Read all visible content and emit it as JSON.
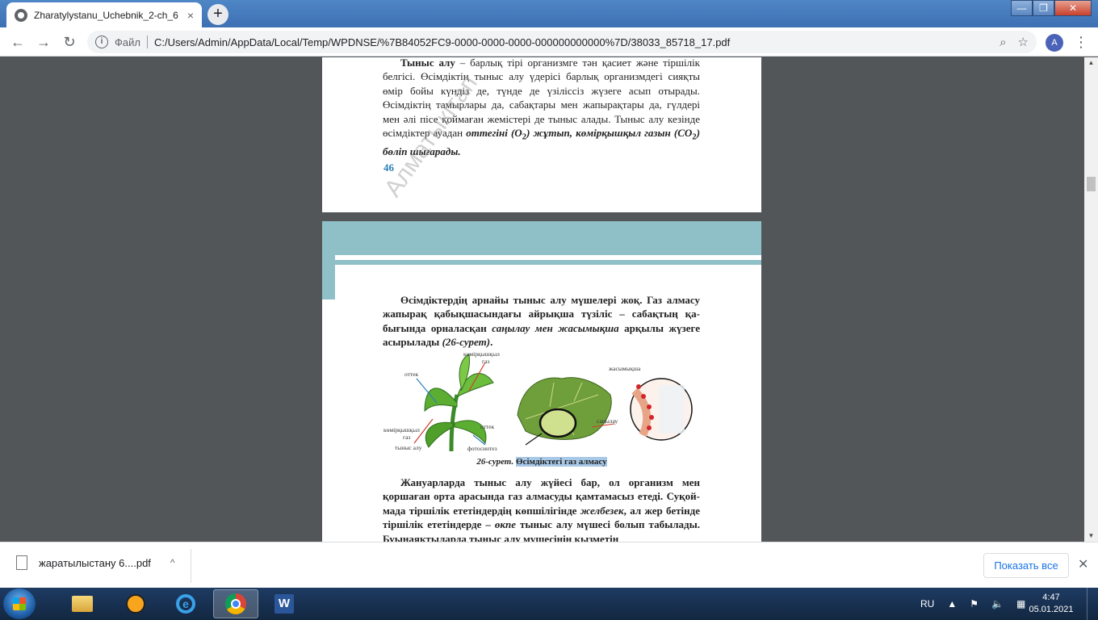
{
  "tab": {
    "title": "Zharatylystanu_Uchebnik_2-ch_6",
    "close": "×",
    "new_tab": "+"
  },
  "window": {
    "minimize": "—",
    "maximize": "❐",
    "close": "✕"
  },
  "toolbar": {
    "back": "←",
    "forward": "→",
    "reload": "↻",
    "scheme": "Файл",
    "url": "C:/Users/Admin/AppData/Local/Temp/WPDNSE/%7B84052FC9-0000-0000-0000-000000000000%7D/38033_85718_17.pdf",
    "zoom_icon": "⌕",
    "star_icon": "☆",
    "avatar": "A",
    "menu": "⋮"
  },
  "page1": {
    "bold_term": "Тыныс алу",
    "text": " – барлық тірі организмге тән қасиет және тір­шілік белгісі. Өсімдіктің тыныс алу үдерісі барлық организмде­гі сияқты өмір бойы күндіз де, түнде де үзіліссіз жүзеге асып отырады. Өсімдіктің тамырлары да, сабақтары мен жапы­рақтары да, гүлдері мен әлі пісе қоймаған жемістері де тыныс алады. Тыныс алу кезінде өсімдіктер ауадан ",
    "italic1": "оттегіні (O",
    "sub1": "2",
    "italic1b": ") жұтып, көмірқышқыл газын (CO",
    "sub2": "2",
    "italic1c": ") бөліп шығарады.",
    "page_number": "46",
    "watermark": "Алматыкітап"
  },
  "page2": {
    "para1_a": "Өсімдіктердің арнайы тыныс алу мүшелері жоқ. Газ алмасу жапырақ қабықшасындағы айрықша түзіліс – сабақтың қа­бығында орналасқан ",
    "para1_italic": "саңылау мен жасымықша",
    "para1_b": " арқылы жүзеге асырылады ",
    "para1_ref": "(26-сурет)",
    "para1_end": ".",
    "figure_labels": {
      "co2_top_1": "көмірқышқыл",
      "co2_top_2": "газ",
      "oxygen_left": "оттек",
      "oxygen_right": "оттек",
      "co2_bottom_1": "көмірқышқыл",
      "co2_bottom_2": "газ",
      "respiration": "тыныс алу",
      "photosynthesis": "фотосинтез",
      "lenticel": "жасымықша",
      "stoma": "саңылау"
    },
    "caption_num": "26-сурет.",
    "caption_text": "Өсімдіктегі газ алмасу",
    "para2_a": "Жануарларда тыныс алу жүйесі бар, ол организм мен қоршаған орта арасында газ алмасуды қамтамасыз етеді. Суқой­мада тіршілік ететіндердің көпшілігінде ",
    "para2_i1": "желбезек",
    "para2_b": ", ал жер бетінде тіршілік ететіндерде – ",
    "para2_i2": "өкпе",
    "para2_c": " тыныс алу мүшесі болып табылады. Буынаяқтыларда тыныс алу мүшесінің қызметін"
  },
  "download_bar": {
    "filename": "жаратылыстану 6....pdf",
    "chevron": "^",
    "show_all": "Показать все",
    "close": "✕"
  },
  "taskbar": {
    "lang": "RU",
    "tray_up": "▲",
    "time": "4:47",
    "date": "05.01.2021"
  },
  "scrollbar": {
    "up": "▲",
    "down": "▼"
  },
  "colors": {
    "accent_band": "#8fc0c8",
    "page_number": "#2a7fb8",
    "highlight": "#a7c8e6"
  }
}
